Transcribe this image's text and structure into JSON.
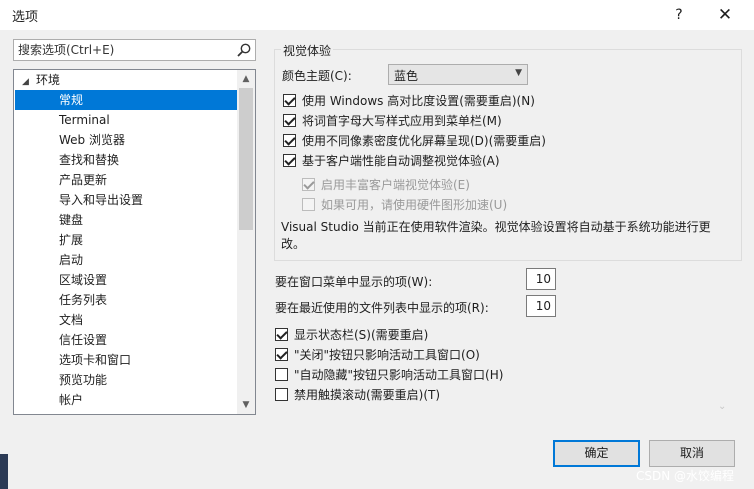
{
  "window": {
    "title": "选项",
    "help_glyph": "?",
    "close_glyph": "✕"
  },
  "search": {
    "placeholder": "搜索选项(Ctrl+E)"
  },
  "tree": {
    "root": "环境",
    "items": [
      {
        "label": "常规",
        "selected": true
      },
      {
        "label": "Terminal"
      },
      {
        "label": "Web 浏览器"
      },
      {
        "label": "查找和替换"
      },
      {
        "label": "产品更新"
      },
      {
        "label": "导入和导出设置"
      },
      {
        "label": "键盘"
      },
      {
        "label": "扩展"
      },
      {
        "label": "启动"
      },
      {
        "label": "区域设置"
      },
      {
        "label": "任务列表"
      },
      {
        "label": "文档"
      },
      {
        "label": "信任设置"
      },
      {
        "label": "选项卡和窗口"
      },
      {
        "label": "预览功能"
      },
      {
        "label": "帐户"
      }
    ]
  },
  "visual": {
    "group_title": "视觉体验",
    "theme_label": "颜色主题(C):",
    "theme_value": "蓝色",
    "checkboxes": [
      {
        "label": "使用 Windows 高对比度设置(需要重启)(N)",
        "checked": true
      },
      {
        "label": "将词首字母大写样式应用到菜单栏(M)",
        "checked": true
      },
      {
        "label": "使用不同像素密度优化屏幕呈现(D)(需要重启)",
        "checked": true
      },
      {
        "label": "基于客户端性能自动调整视觉体验(A)",
        "checked": true
      }
    ],
    "sub_checkboxes": [
      {
        "label": "启用丰富客户端视觉体验(E)",
        "checked": true
      },
      {
        "label": "如果可用，请使用硬件图形加速(U)",
        "checked": false
      }
    ],
    "info": "Visual Studio 当前正在使用软件渲染。视觉体验设置将自动基于系统功能进行更改。"
  },
  "window_menu": {
    "label": "要在窗口菜单中显示的项(W):",
    "value": "10"
  },
  "recent_files": {
    "label": "要在最近使用的文件列表中显示的项(R):",
    "value": "10"
  },
  "bottom_checkboxes": [
    {
      "label": "显示状态栏(S)(需要重启)",
      "checked": true
    },
    {
      "label": "\"关闭\"按钮只影响活动工具窗口(O)",
      "checked": true
    },
    {
      "label": "\"自动隐藏\"按钮只影响活动工具窗口(H)",
      "checked": false
    },
    {
      "label": "禁用触摸滚动(需要重启)(T)",
      "checked": false
    }
  ],
  "buttons": {
    "ok": "确定",
    "cancel": "取消"
  },
  "watermark": "CSDN @水饺编程",
  "colors": {
    "accent": "#0078d7",
    "background": "#f0f0f0"
  }
}
